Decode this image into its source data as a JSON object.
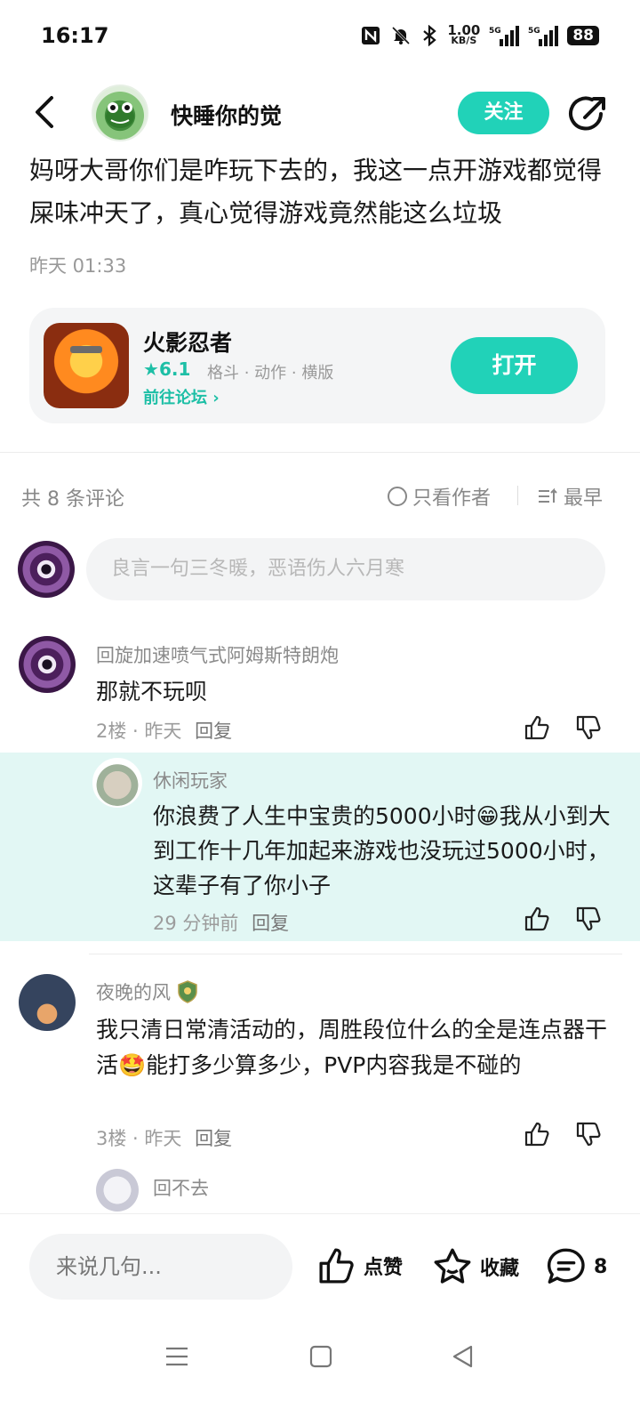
{
  "status_bar": {
    "time": "16:17",
    "net_speed_value": "1.00",
    "net_speed_unit": "KB/S",
    "signal1_label": "5G",
    "signal2_label": "5G",
    "battery": "88"
  },
  "header": {
    "author_name": "快睡你的觉",
    "follow_label": "关注"
  },
  "post": {
    "text": "妈呀大哥你们是咋玩下去的，我这一点开游戏都觉得屎味冲天了，真心觉得游戏竟然能这么垃圾",
    "time": "昨天 01:33"
  },
  "game_card": {
    "name": "火影忍者",
    "rating": "6.1",
    "tags": "格斗 · 动作 · 横版",
    "forum_link": "前往论坛",
    "open_label": "打开"
  },
  "comments_header": {
    "count_text": "共 8 条评论",
    "author_only": "只看作者",
    "sort": "最早"
  },
  "comment_input": {
    "placeholder": "良言一句三冬暖，恶语伤人六月寒"
  },
  "comments": [
    {
      "name": "回旋加速喷气式阿姆斯特朗炮",
      "text": "那就不玩呗",
      "meta": "2楼 · 昨天",
      "reply_label": "回复"
    },
    {
      "name": "休闲玩家",
      "text": "你浪费了人生中宝贵的5000小时😁我从小到大到工作十几年加起来游戏也没玩过5000小时，这辈子有了你小子",
      "meta": "29 分钟前",
      "reply_label": "回复"
    },
    {
      "name": "夜晚的风",
      "text": "我只清日常清活动的，周胜段位什么的全是连点器干活🤩能打多少算多少，PVP内容我是不碰的",
      "meta": "3楼 · 昨天",
      "reply_label": "回复"
    },
    {
      "name": "回不去",
      "text": ""
    }
  ],
  "bottom_bar": {
    "input_placeholder": "来说几句...",
    "like_label": "点赞",
    "fav_label": "收藏",
    "comment_count": "8"
  },
  "colors": {
    "accent": "#21d2b8",
    "accent_text": "#1dbfa6",
    "reply_bg": "#e2f7f4"
  }
}
